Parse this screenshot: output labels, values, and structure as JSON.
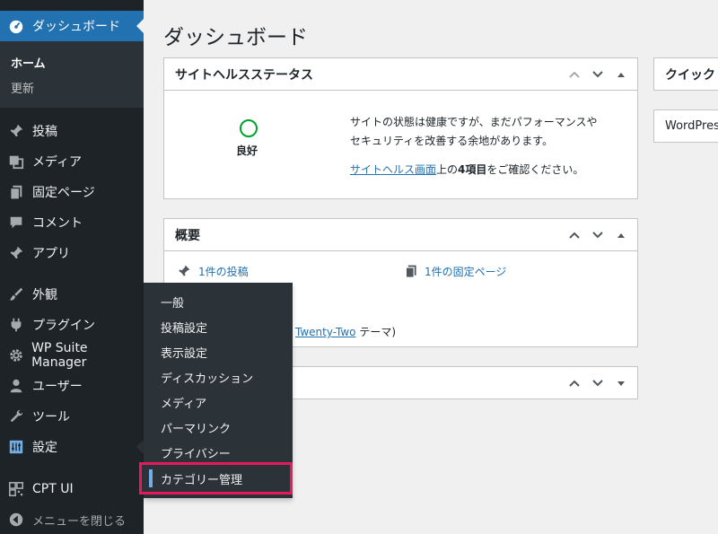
{
  "sidebar": {
    "dashboard": "ダッシュボード",
    "sub": {
      "home": "ホーム",
      "updates": "更新"
    },
    "items": {
      "posts": "投稿",
      "media": "メディア",
      "pages": "固定ページ",
      "comments": "コメント",
      "apps": "アプリ",
      "appearance": "外観",
      "plugins": "プラグイン",
      "wpsuite": "WP Suite Manager",
      "users": "ユーザー",
      "tools": "ツール",
      "settings": "設定",
      "cptui": "CPT UI",
      "collapse": "メニューを閉じる"
    }
  },
  "flyout": {
    "items": [
      "一般",
      "投稿設定",
      "表示設定",
      "ディスカッション",
      "メディア",
      "パーマリンク",
      "プライバシー",
      "カテゴリー管理"
    ]
  },
  "content": {
    "title": "ダッシュボード",
    "site_health": {
      "header": "サイトヘルスステータス",
      "status": "良好",
      "line1": "サイトの状態は健康ですが、まだパフォーマンスや",
      "line2": "セキュリティを改善する余地があります。",
      "link": "サイトヘルス画面",
      "after_link_pre": "上の",
      "after_link_bold": "4項目",
      "after_link_post": "をご確認ください。"
    },
    "at_a_glance": {
      "header": "概要",
      "posts": "1件の投稿",
      "pages": "1件の固定ページ",
      "theme_link": "Twenty-Two",
      "theme_suffix": "テーマ)"
    },
    "quick_draft": {
      "header": "クイック"
    },
    "wp_events": {
      "header": "WordPres"
    }
  },
  "colors": {
    "sidebar_bg": "#1d2327",
    "accent": "#2271b1",
    "highlight_border": "#e5195b",
    "health_good": "#00a32a"
  }
}
